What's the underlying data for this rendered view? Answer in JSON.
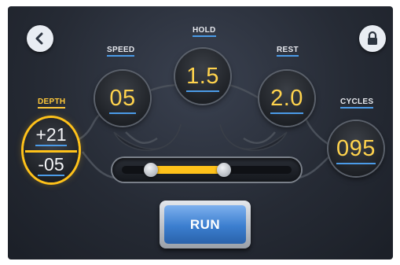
{
  "header": {
    "back_icon": "chevron-left-icon",
    "lock_icon": "lock-icon"
  },
  "settings": {
    "depth": {
      "label": "DEPTH",
      "upper_value": "+21",
      "lower_value": "-05"
    },
    "speed": {
      "label": "SPEED",
      "value": "05"
    },
    "hold": {
      "label": "HOLD",
      "value": "1.5"
    },
    "rest": {
      "label": "REST",
      "value": "2.0"
    },
    "cycles": {
      "label": "CYCLES",
      "value": "095"
    }
  },
  "range_slider": {
    "low": 0.17,
    "high": 0.6,
    "fill_color": "#ffc21a"
  },
  "run_button": {
    "label": "RUN"
  },
  "colors": {
    "accent": "#ffd34d",
    "underline": "#4b9be8",
    "depth_ring": "#ffc21a",
    "run": "#3b7ecf"
  }
}
